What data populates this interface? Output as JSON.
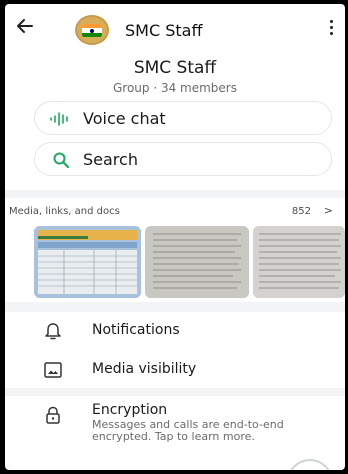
{
  "header": {
    "title": "SMC Staff",
    "back_icon": "arrow-left-icon",
    "menu_icon": "more-vertical-icon",
    "avatar": "india-flag-avatar"
  },
  "group": {
    "name": "SMC Staff",
    "subtitle": "Group · 34 members"
  },
  "actions": {
    "voice_chat": "Voice chat",
    "search": "Search"
  },
  "media": {
    "title": "Media, links, and docs",
    "count": "852",
    "chevron": ">"
  },
  "settings": {
    "notifications": "Notifications",
    "media_visibility": "Media visibility"
  },
  "encryption": {
    "title": "Encryption",
    "description": "Messages and calls are end-to-end encrypted. Tap to learn more."
  },
  "colors": {
    "accent": "#1daa61",
    "text": "#1a1a1a",
    "muted": "#6b6b6b"
  }
}
